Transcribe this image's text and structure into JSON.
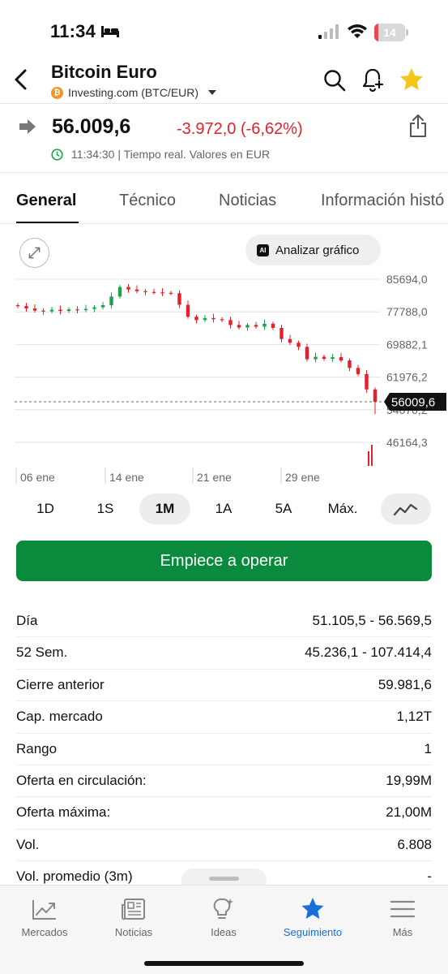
{
  "status_bar": {
    "time": "11:34",
    "battery": "14",
    "battery_level": 0.14
  },
  "header": {
    "title": "Bitcoin Euro",
    "source": "Investing.com (BTC/EUR)",
    "coin_symbol": "₿"
  },
  "quote": {
    "price": "56.009,6",
    "change": "-3.972,0 (-6,62%)",
    "realtime": "11:34:30 | Tiempo real. Valores en EUR",
    "change_color": "#e5202a"
  },
  "tabs": [
    "General",
    "Técnico",
    "Noticias",
    "Información histó"
  ],
  "chart": {
    "analyze_label": "Analizar gráfico",
    "ai_badge": "AI"
  },
  "chart_data": {
    "type": "candlestick",
    "y_ticks": [
      "85694,0",
      "77788,0",
      "69882,1",
      "61976,2",
      "54070,2",
      "46164,3"
    ],
    "y_tick_values": [
      85694.0,
      77788.0,
      69882.1,
      61976.2,
      54070.2,
      46164.3
    ],
    "x_ticks": [
      "06 ene",
      "14 ene",
      "21 ene",
      "29 ene"
    ],
    "current_price_label": "56009,6",
    "current_price": 56009.6,
    "closes": [
      79200,
      78600,
      78100,
      77900,
      78300,
      78000,
      78400,
      78200,
      78500,
      78900,
      79400,
      81500,
      83800,
      83200,
      82800,
      82600,
      82500,
      82400,
      82300,
      79500,
      76600,
      75800,
      76300,
      76000,
      75800,
      74600,
      74000,
      74600,
      74200,
      74900,
      73900,
      71200,
      70300,
      69300,
      66300,
      66900,
      66400,
      66800,
      66000,
      64200,
      62700,
      59000,
      56009.6
    ]
  },
  "ranges": [
    "1D",
    "1S",
    "1M",
    "1A",
    "5A",
    "Máx."
  ],
  "cta_label": "Empiece a operar",
  "stats": [
    {
      "label": "Día",
      "value": "51.105,5 - 56.569,5"
    },
    {
      "label": "52 Sem.",
      "value": "45.236,1 - 107.414,4"
    },
    {
      "label": "Cierre anterior",
      "value": "59.981,6"
    },
    {
      "label": "Cap. mercado",
      "value": "1,12T"
    },
    {
      "label": "Rango",
      "value": "1"
    },
    {
      "label": "Oferta en circulación:",
      "value": "19,99M"
    },
    {
      "label": "Oferta máxima:",
      "value": "21,00M"
    },
    {
      "label": "Vol.",
      "value": "6.808"
    },
    {
      "label": "Vol. promedio (3m)",
      "value": "-"
    }
  ],
  "bottom_nav": [
    {
      "label": "Mercados",
      "icon": "chart-trend-icon"
    },
    {
      "label": "Noticias",
      "icon": "newspaper-icon"
    },
    {
      "label": "Ideas",
      "icon": "lightbulb-icon"
    },
    {
      "label": "Seguimiento",
      "icon": "star-icon"
    },
    {
      "label": "Más",
      "icon": "menu-icon"
    }
  ],
  "colors": {
    "accent": "#1a6ed8",
    "cta": "#0a8a3c",
    "up": "#1aa34a",
    "down": "#e5202a",
    "star": "#f5c518"
  }
}
